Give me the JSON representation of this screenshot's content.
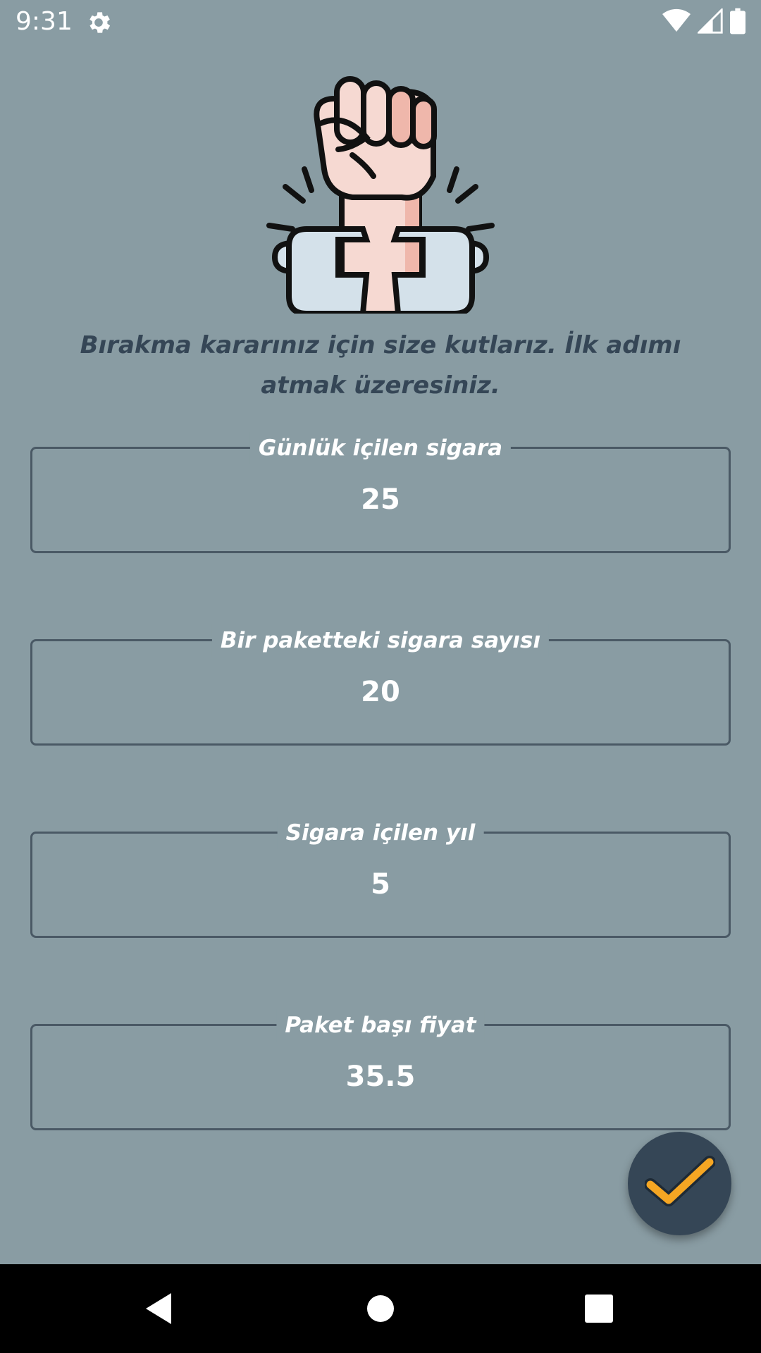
{
  "status_bar": {
    "time": "9:31",
    "icons": [
      "gear-icon",
      "wifi-icon",
      "signal-icon",
      "battery-icon"
    ]
  },
  "hero": {
    "icon": "broken-chain-fist-icon"
  },
  "intro_text": "Bırakma kararınız için size kutlarız. İlk adımı atmak üzeresiniz.",
  "fields": [
    {
      "label": "Günlük içilen sigara",
      "value": "25"
    },
    {
      "label": "Bir paketteki sigara sayısı",
      "value": "20"
    },
    {
      "label": "Sigara içilen yıl",
      "value": "5"
    },
    {
      "label": "Paket başı fiyat",
      "value": "35.5"
    }
  ],
  "fab": {
    "icon": "check-icon",
    "icon_color": "#f5a623",
    "background": "#354656"
  },
  "nav_bar": {
    "icons": [
      "back-icon",
      "home-icon",
      "recents-icon"
    ]
  },
  "colors": {
    "background": "#899ca3",
    "text_dark": "#354656",
    "border": "#4a5965"
  }
}
